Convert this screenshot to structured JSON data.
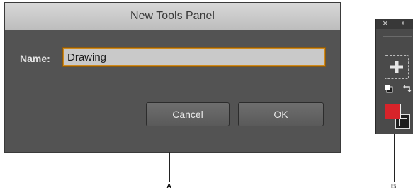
{
  "dialog": {
    "title": "New Tools Panel",
    "name_label": "Name:",
    "name_value": "Drawing",
    "cancel_label": "Cancel",
    "ok_label": "OK",
    "accent_color": "#d08a1a"
  },
  "tools_panel": {
    "close_glyph": "×",
    "collapse_glyph": "››",
    "icons": [
      "close-icon",
      "collapse-icon",
      "add-tool-icon",
      "default-colors-icon",
      "swap-colors-icon"
    ],
    "fill_color": "#d8232a",
    "stroke_color": "#1e1e1e"
  },
  "callouts": {
    "a": "A",
    "b": "B"
  }
}
